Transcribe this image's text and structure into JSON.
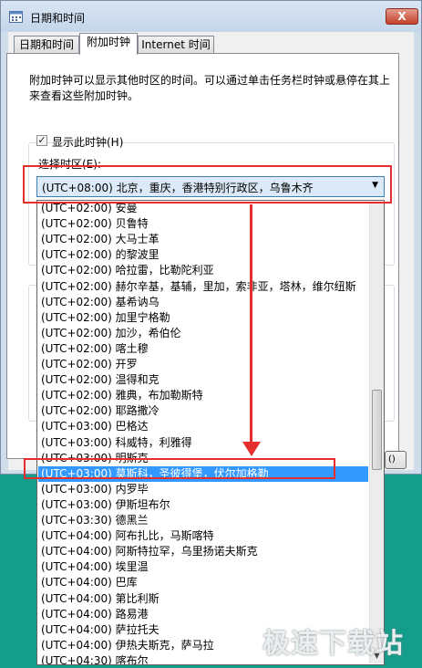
{
  "window": {
    "title": "日期和时间",
    "close_label": "X",
    "tabs": [
      "日期和时间",
      "附加时钟",
      "Internet 时间"
    ],
    "active_tab": 1
  },
  "page": {
    "description": "附加时钟可以显示其他时区的时间。可以通过单击任务栏时钟或悬停在其上来查看这些附加时钟。",
    "show_clock_label": "显示此时钟(H)",
    "show_clock_checked": true,
    "select_timezone_label": "选择时区(E):"
  },
  "combo": {
    "selected": "(UTC+08:00) 北京，重庆，香港特别行政区，乌鲁木齐",
    "arrow": "▼"
  },
  "dropdown": {
    "items": [
      "(UTC+02:00) 安曼",
      "(UTC+02:00) 贝鲁特",
      "(UTC+02:00) 大马士革",
      "(UTC+02:00) 的黎波里",
      "(UTC+02:00) 哈拉雷，比勒陀利亚",
      "(UTC+02:00) 赫尔辛基，基辅，里加，索非亚，塔林，维尔纽斯",
      "(UTC+02:00) 基希讷乌",
      "(UTC+02:00) 加里宁格勒",
      "(UTC+02:00) 加沙，希伯伦",
      "(UTC+02:00) 喀土穆",
      "(UTC+02:00) 开罗",
      "(UTC+02:00) 温得和克",
      "(UTC+02:00) 雅典，布加勒斯特",
      "(UTC+02:00) 耶路撒冷",
      "(UTC+03:00) 巴格达",
      "(UTC+03:00) 科威特，利雅得",
      "(UTC+03:00) 明斯克",
      "(UTC+03:00) 莫斯科，圣彼得堡，伏尔加格勒",
      "(UTC+03:00) 内罗毕",
      "(UTC+03:00) 伊斯坦布尔",
      "(UTC+03:30) 德黑兰",
      "(UTC+04:00) 阿布扎比，马斯喀特",
      "(UTC+04:00) 阿斯特拉罕，乌里扬诺夫斯克",
      "(UTC+04:00) 埃里温",
      "(UTC+04:00) 巴库",
      "(UTC+04:00) 第比利斯",
      "(UTC+04:00) 路易港",
      "(UTC+04:00) 萨拉托夫",
      "(UTC+04:00) 伊热夫斯克，萨马拉",
      "(UTC+04:30) 喀布尔"
    ],
    "selected_index": 17,
    "scroll_down_glyph": "▼"
  },
  "footer": {
    "ok_partial": "()"
  },
  "watermark": "极速下载站",
  "colors": {
    "highlight_red": "#e52d2d",
    "selection_blue": "#3399ff",
    "teal_background": "#159d8c"
  }
}
